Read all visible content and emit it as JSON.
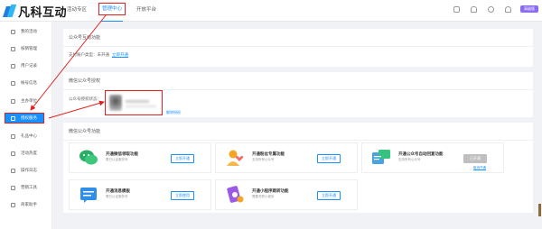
{
  "brand": {
    "name": "凡科互动"
  },
  "nav": {
    "items": [
      {
        "label": "活动专区",
        "active": false
      },
      {
        "label": "管理中心",
        "active": true
      },
      {
        "label": "开放平台",
        "active": false
      }
    ]
  },
  "topbar": {
    "icons": [
      "calendar-icon",
      "bell-icon",
      "help-icon",
      "user-icon"
    ],
    "badge": "高级版"
  },
  "sidebar": {
    "items": [
      {
        "label": "我的活动",
        "icon": "user-icon",
        "active": false
      },
      {
        "label": "核销管理",
        "icon": "ticket-icon",
        "active": false
      },
      {
        "label": "用户记录",
        "icon": "record-icon",
        "active": false
      },
      {
        "label": "帐号信息",
        "icon": "account-icon",
        "active": false
      },
      {
        "label": "主办单位",
        "icon": "org-icon",
        "active": false
      },
      {
        "label": "授权服务",
        "icon": "auth-icon",
        "active": true
      },
      {
        "label": "礼品中心",
        "icon": "gift-icon",
        "active": false
      },
      {
        "label": "活动热度",
        "icon": "heat-icon",
        "active": false
      },
      {
        "label": "操作日志",
        "icon": "log-icon",
        "active": false
      },
      {
        "label": "营销工具",
        "icon": "tool-icon",
        "active": false
      },
      {
        "label": "商家助手",
        "icon": "helper-icon",
        "active": false
      }
    ]
  },
  "main": {
    "card1": {
      "title": "公众号互动功能",
      "row_label": "支付账户类型：未开通",
      "row_link": "立即开通"
    },
    "card2": {
      "title": "微信公众号授权",
      "auth_label": "公众号授权状态：",
      "unbind_link": "解除授权"
    },
    "card3": {
      "title": "微信公众号功能",
      "features": [
        {
          "title": "开通微信领取功能",
          "desc": "需已认证服务号",
          "button": "立即开通",
          "icon": "wechat-icon"
        },
        {
          "title": "开通粉丝专属功能",
          "desc": "支持所有公众号",
          "button": "立即开通",
          "icon": "fans-icon"
        },
        {
          "title": "开通公众号自动回复功能",
          "desc": "支持所有公众号",
          "button": "已开通",
          "sub_link": "取消开通",
          "icon": "reply-icon"
        },
        {
          "title": "开通消息模板",
          "desc": "需已认证服务号",
          "button": "立即使用",
          "icon": "message-icon"
        },
        {
          "title": "开通小程序跳转功能",
          "desc": "需要关联小程序",
          "button": "立即开通",
          "icon": "miniprogram-icon"
        }
      ]
    }
  },
  "colors": {
    "accent": "#1890ff",
    "highlight_box": "#e02020",
    "badge": "#8b6cf0",
    "sidebar_active": "#1890ff"
  }
}
